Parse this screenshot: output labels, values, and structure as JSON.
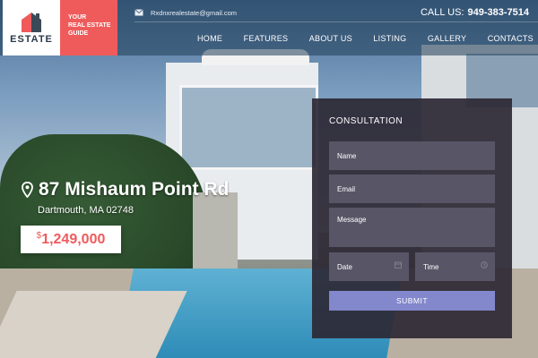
{
  "brand": {
    "logo_text": "ESTATE",
    "tagline": [
      "YOUR",
      "REAL ESTATE",
      "GUIDE"
    ],
    "accent": "#ef5b5b"
  },
  "header": {
    "email": "Rxdnxrealestate@gmail.com",
    "phone_label": "CALL US:",
    "phone_number": "949-383-7514"
  },
  "nav": [
    "HOME",
    "FEATURES",
    "ABOUT US",
    "LISTING",
    "GALLERY",
    "CONTACTS"
  ],
  "listing": {
    "street": "87 Mishaum Point Rd",
    "city": "Dartmouth, MA 02748",
    "currency": "$",
    "price": "1,249,000"
  },
  "form": {
    "title": "CONSULTATION",
    "name": "Name",
    "email": "Email",
    "message": "Message",
    "date": "Date",
    "time": "Time",
    "submit": "SUBMIT",
    "submit_color": "#8387cc"
  }
}
